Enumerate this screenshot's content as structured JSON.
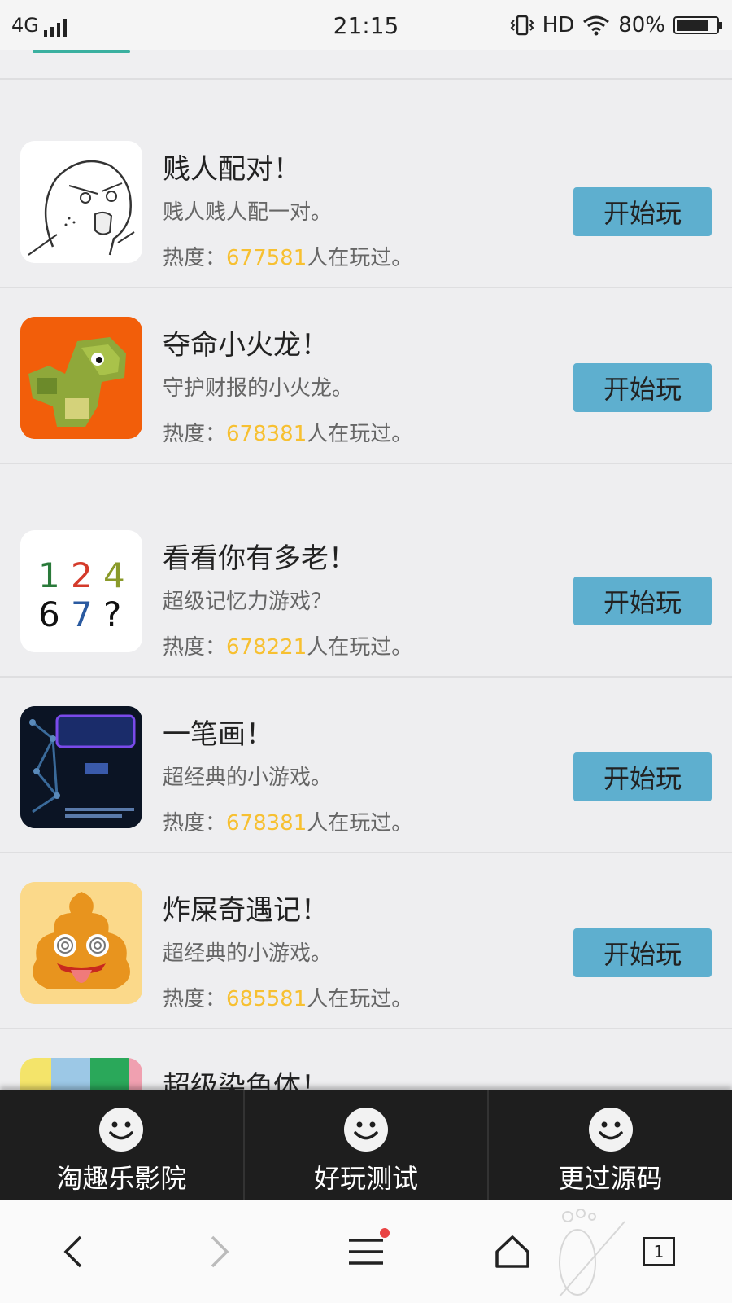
{
  "status_bar": {
    "network": "4G",
    "time": "21:15",
    "hd": "HD",
    "battery": "80%",
    "battery_level": 0.8
  },
  "games": [
    {
      "title": "贱人配对！",
      "desc": "贱人贱人配一对。",
      "heat_label": "热度：",
      "heat_value": "677581",
      "heat_suffix": "人在玩过。",
      "button": "开始玩",
      "icon": "rage-face-icon"
    },
    {
      "title": "夺命小火龙！",
      "desc": "守护财报的小火龙。",
      "heat_label": "热度：",
      "heat_value": "678381",
      "heat_suffix": "人在玩过。",
      "button": "开始玩",
      "icon": "pixel-dragon-icon"
    },
    {
      "title": "看看你有多老！",
      "desc": "超级记忆力游戏？",
      "heat_label": "热度：",
      "heat_value": "678221",
      "heat_suffix": "人在玩过。",
      "button": "开始玩",
      "icon": "numbers-icon",
      "icon_text": [
        "1",
        "2",
        "4",
        "6",
        "7",
        "?"
      ]
    },
    {
      "title": "一笔画！",
      "desc": "超经典的小游戏。",
      "heat_label": "热度：",
      "heat_value": "678381",
      "heat_suffix": "人在玩过。",
      "button": "开始玩",
      "icon": "one-stroke-icon"
    },
    {
      "title": "炸屎奇遇记！",
      "desc": "超经典的小游戏。",
      "heat_label": "热度：",
      "heat_value": "685581",
      "heat_suffix": "人在玩过。",
      "button": "开始玩",
      "icon": "poop-icon"
    },
    {
      "title": "超级染色体！",
      "icon": "color-blocks-icon"
    }
  ],
  "bottom_nav": [
    {
      "label": "淘趣乐影院",
      "icon": "smiley-icon"
    },
    {
      "label": "好玩测试",
      "icon": "smiley-icon"
    },
    {
      "label": "更过源码",
      "icon": "smiley-icon"
    }
  ],
  "browser_bar": {
    "tab_count": "1",
    "icons": [
      "back-icon",
      "forward-icon",
      "menu-icon",
      "home-icon",
      "tabs-icon"
    ]
  },
  "colors": {
    "heat_number": "#f7c031",
    "button_bg": "#5eafcf",
    "nav_bg": "#1e1e1e",
    "list_bg": "#eeeef0"
  }
}
